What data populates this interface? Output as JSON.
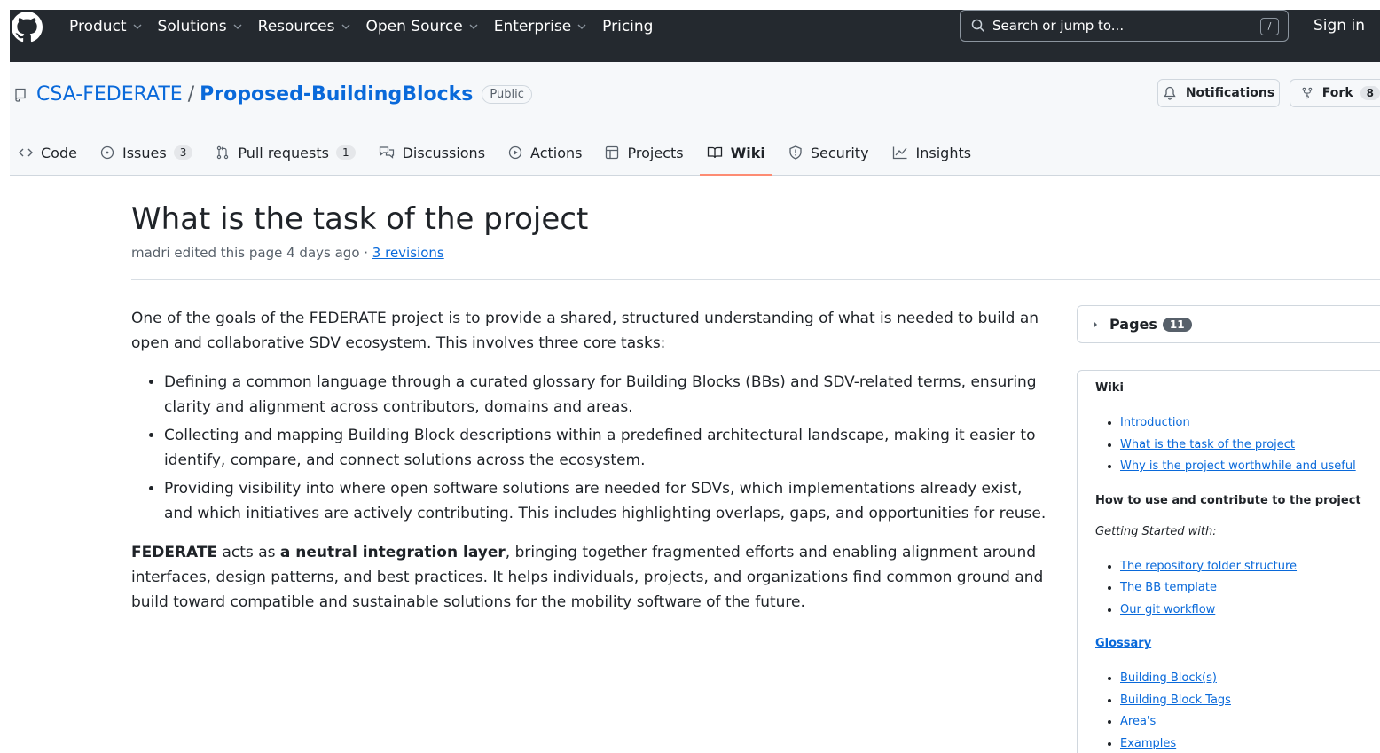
{
  "topnav": {
    "items": [
      "Product",
      "Solutions",
      "Resources",
      "Open Source",
      "Enterprise",
      "Pricing"
    ],
    "search_placeholder": "Search or jump to...",
    "search_shortcut": "/",
    "signin": "Sign in"
  },
  "repo": {
    "owner": "CSA-FEDERATE",
    "separator": "/",
    "name": "Proposed-BuildingBlocks",
    "visibility": "Public",
    "notifications": "Notifications",
    "fork": "Fork",
    "fork_count": "8"
  },
  "tabs": [
    {
      "label": "Code",
      "count": ""
    },
    {
      "label": "Issues",
      "count": "3"
    },
    {
      "label": "Pull requests",
      "count": "1"
    },
    {
      "label": "Discussions",
      "count": ""
    },
    {
      "label": "Actions",
      "count": ""
    },
    {
      "label": "Projects",
      "count": ""
    },
    {
      "label": "Wiki",
      "count": ""
    },
    {
      "label": "Security",
      "count": ""
    },
    {
      "label": "Insights",
      "count": ""
    }
  ],
  "page": {
    "title": "What is the task of the project",
    "meta_text": "madri edited this page 4 days ago · ",
    "revisions": "3 revisions",
    "intro": "One of the goals of the FEDERATE project is to provide a shared, structured understanding of what is needed to build an open and collaborative SDV ecosystem. This involves three core tasks:",
    "bullets": [
      "Defining a common language through a curated glossary for Building Blocks (BBs) and SDV-related terms, ensuring clarity and alignment across contributors, domains and areas.",
      "Collecting and mapping Building Block descriptions within a predefined architectural landscape, making it easier to identify, compare, and connect solutions across the ecosystem.",
      "Providing visibility into where open software solutions are needed for SDVs, which implementations already exist, and which initiatives are actively contributing. This includes highlighting overlaps, gaps, and opportunities for reuse."
    ],
    "para2_b1": "FEDERATE",
    "para2_t1": " acts as ",
    "para2_b2": "a neutral integration layer",
    "para2_t2": ", bringing together fragmented efforts and enabling alignment around interfaces, design patterns, and best practices. It helps individuals, projects, and organizations find common ground and build toward compatible and sustainable solutions for the mobility software of the future."
  },
  "sidebar": {
    "pages_label": "Pages",
    "pages_count": "11",
    "wiki_heading": "Wiki",
    "wiki_links": [
      "Introduction",
      "What is the task of the project",
      "Why is the project worthwhile and useful"
    ],
    "howto_heading": "How to use and contribute to the project",
    "getting_started": "Getting Started with:",
    "getting_links": [
      "The repository folder structure",
      "The BB template",
      "Our git workflow"
    ],
    "glossary": "Glossary",
    "glossary_links": [
      "Building Block(s)",
      "Building Block Tags",
      "Area's",
      "Examples"
    ]
  }
}
